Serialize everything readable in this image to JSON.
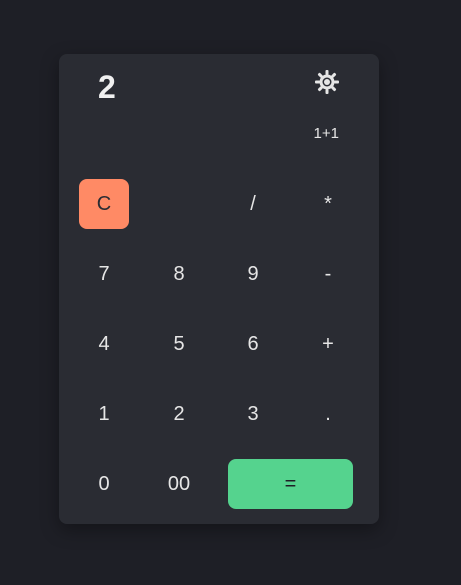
{
  "display": {
    "result": "2",
    "expression": "1+1"
  },
  "theme_toggle": {
    "icon": "sun-icon"
  },
  "keys": {
    "clear": "C",
    "divide": "/",
    "multiply": "*",
    "seven": "7",
    "eight": "8",
    "nine": "9",
    "subtract": "-",
    "four": "4",
    "five": "5",
    "six": "6",
    "add": "+",
    "one": "1",
    "two": "2",
    "three": "3",
    "decimal": ".",
    "zero": "0",
    "double_zero": "00",
    "equals": "="
  },
  "colors": {
    "background": "#1e1f26",
    "panel": "#2a2c33",
    "clear_key": "#ff8a65",
    "equals_key": "#55d38e",
    "text": "#e6e6e6"
  }
}
